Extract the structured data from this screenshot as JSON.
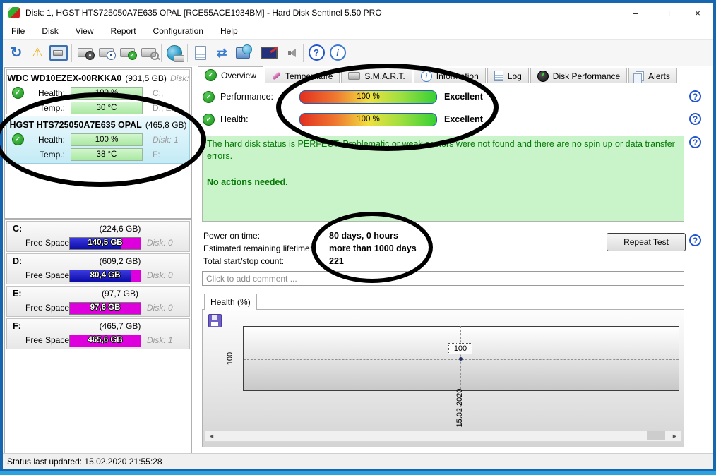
{
  "window": {
    "title": "Disk: 1, HGST HTS725050A7E635  OPAL [RCE55ACE1934BM]  -  Hard Disk Sentinel 5.50 PRO",
    "controls": {
      "minimize": "–",
      "maximize": "□",
      "close": "×"
    }
  },
  "menu": {
    "items": [
      "File",
      "Disk",
      "View",
      "Report",
      "Configuration",
      "Help"
    ]
  },
  "toolbar": {
    "icons": [
      {
        "name": "refresh-icon",
        "glyph": "↻"
      },
      {
        "name": "alert-refresh-icon",
        "glyph": "⚠"
      },
      {
        "name": "disk-properties-icon",
        "glyph": ""
      },
      {
        "name": "disk-gauge-icon",
        "glyph": ""
      },
      {
        "name": "disk-clock-icon",
        "glyph": ""
      },
      {
        "name": "disk-check-icon",
        "glyph": "✓"
      },
      {
        "name": "disk-search-icon",
        "glyph": ""
      },
      {
        "name": "globe-disk-icon",
        "glyph": ""
      },
      {
        "name": "report-icon",
        "glyph": ""
      },
      {
        "name": "sync-icon",
        "glyph": "⇄"
      },
      {
        "name": "network-icon",
        "glyph": ""
      },
      {
        "name": "monitor-test-icon",
        "glyph": ""
      },
      {
        "name": "speaker-icon",
        "glyph": ""
      },
      {
        "name": "help-icon",
        "glyph": "?"
      },
      {
        "name": "info-icon",
        "glyph": "i"
      }
    ]
  },
  "tabs": {
    "items": [
      {
        "label": "Overview"
      },
      {
        "label": "Temperature"
      },
      {
        "label": "S.M.A.R.T."
      },
      {
        "label": "Information"
      },
      {
        "label": "Log"
      },
      {
        "label": "Disk Performance"
      },
      {
        "label": "Alerts"
      }
    ]
  },
  "sidebar": {
    "disks": [
      {
        "name": "WDC WD10EZEX-00RKKA0",
        "size": "(931,5 GB)",
        "extra": "Disk:",
        "health_label": "Health:",
        "health_value": "100 %",
        "health_note": "C:,",
        "temp_label": "Temp.:",
        "temp_value": "30 °C",
        "temp_note": "D:, E:"
      },
      {
        "name": "HGST HTS725050A7E635  OPAL",
        "size": "(465,8 GB)",
        "extra": "",
        "health_label": "Health:",
        "health_value": "100 %",
        "health_note": "Disk: 1",
        "temp_label": "Temp.:",
        "temp_value": "38 °C",
        "temp_note": "F:"
      }
    ],
    "partitions": [
      {
        "letter": "C:",
        "size": "(224,6 GB)",
        "free_label": "Free Space",
        "free_value": "140,5 GB",
        "disk_note": "Disk: 0",
        "used_pct": 72
      },
      {
        "letter": "D:",
        "size": "(609,2 GB)",
        "free_label": "Free Space",
        "free_value": "80,4 GB",
        "disk_note": "Disk: 0",
        "used_pct": 86
      },
      {
        "letter": "E:",
        "size": "(97,7 GB)",
        "free_label": "Free Space",
        "free_value": "97,6 GB",
        "disk_note": "Disk: 0",
        "used_pct": 0
      },
      {
        "letter": "F:",
        "size": "(465,7 GB)",
        "free_label": "Free Space",
        "free_value": "465,6 GB",
        "disk_note": "Disk: 1",
        "used_pct": 0
      }
    ]
  },
  "overview": {
    "performance_label": "Performance:",
    "performance_value": "100 %",
    "performance_rating": "Excellent",
    "health_label": "Health:",
    "health_value": "100 %",
    "health_rating": "Excellent",
    "status_paragraph": "The hard disk status is PERFECT. Problematic or weak sectors were not found and there are no spin up or data transfer errors.",
    "status_action": "No actions needed.",
    "rows": [
      {
        "label": "Power on time:",
        "value": "80 days, 0 hours"
      },
      {
        "label": "Estimated remaining lifetime:",
        "value": "more than 1000 days"
      },
      {
        "label": "Total start/stop count:",
        "value": "221"
      }
    ],
    "repeat_test": "Repeat Test",
    "comment_placeholder": "Click to add comment ..."
  },
  "chart_data": {
    "type": "line",
    "title": "Health (%)",
    "tab_label": "Health (%)",
    "x": [
      "15.02.2020"
    ],
    "series": [
      {
        "name": "Health (%)",
        "values": [
          100
        ]
      }
    ],
    "yticks": [
      "100"
    ],
    "point_label": "100",
    "grid": "dashed-crosshair",
    "legend": "none"
  },
  "status_bar": {
    "text": "Status last updated: 15.02.2020 21:55:28"
  }
}
